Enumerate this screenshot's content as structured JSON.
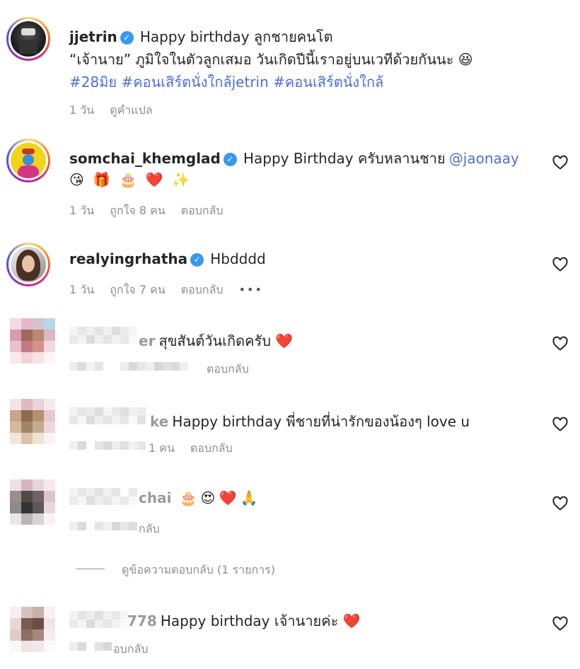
{
  "comments": [
    {
      "username": "jjetrin",
      "verified": true,
      "line1": "Happy birthday ลูกชายคนโต",
      "line2": "“เจ้านาย” ภูมิใจในตัวลูกเสมอ วันเกิดปีนี้เราอยู่บนเวทีด้วยกันนะ 😆",
      "hashtags": "#28มิย #คอนเสิร์ตนั่งใกล้jetrin #คอนเสิร์ตนั่งใกล้",
      "time": "1 วัน",
      "translate": "ดูคำแปล"
    },
    {
      "username": "somchai_khemglad",
      "verified": true,
      "text": "Happy Birthday ครับหลานชาย",
      "mention": "@jaonaay",
      "emojis": [
        "😘",
        "🎁",
        "🎂",
        "❤️",
        "✨"
      ],
      "time": "1 วัน",
      "likes": "ถูกใจ 8 คน",
      "reply": "ตอบกลับ"
    },
    {
      "username": "realyingrhatha",
      "verified": true,
      "text": "Hbdddd",
      "time": "1 วัน",
      "likes": "ถูกใจ 7 คน",
      "reply": "ตอบกลับ",
      "more": "•••"
    },
    {
      "username_tail": "er",
      "text": "สุขสันต์วันเกิดครับ ❤️",
      "reply": "ตอบกลับ"
    },
    {
      "username_tail": "ke",
      "text": "Happy birthday พี่ชายที่น่ารักของน้องๆ love u",
      "likes_tail": "1 คน",
      "reply": "ตอบกลับ"
    },
    {
      "username_tail": "chai",
      "emojis": [
        "🎂",
        "😍",
        "❤️",
        "🙏"
      ],
      "reply_tail": "กลับ"
    },
    {
      "view_replies": "ดูข้อความตอบกลับ (1 รายการ)"
    },
    {
      "username_tail": "778",
      "text": "Happy birthday เจ้านายค่ะ ❤️",
      "reply_tail": "อบกลับ"
    }
  ],
  "icons": {
    "like": "heart-outline-icon",
    "verified": "verified-badge-icon"
  },
  "colors": {
    "link": "#4f6fd6",
    "meta": "#8e8e8e",
    "verified": "#3897f0",
    "heart": "#ed4956"
  }
}
